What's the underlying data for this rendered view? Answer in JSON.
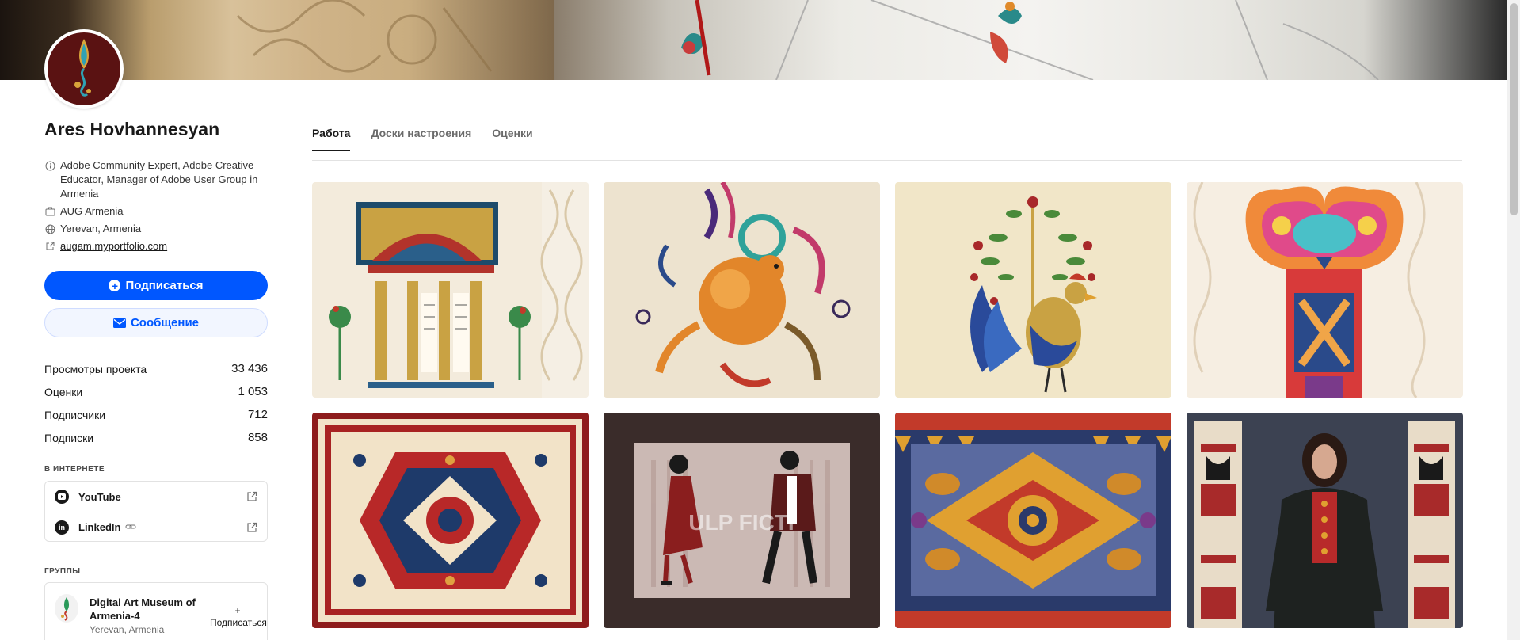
{
  "profile": {
    "name": "Ares Hovhannesyan",
    "bio": "Adobe Community Expert, Adobe Creative Educator, Manager of Adobe User Group in Armenia",
    "company": "AUG Armenia",
    "location": "Yerevan, Armenia",
    "website": "augam.myportfolio.com"
  },
  "actions": {
    "follow_label": "Подписаться",
    "message_label": "Сообщение"
  },
  "stats": [
    {
      "label": "Просмотры проекта",
      "value": "33 436"
    },
    {
      "label": "Оценки",
      "value": "1 053"
    },
    {
      "label": "Подписчики",
      "value": "712"
    },
    {
      "label": "Подписки",
      "value": "858"
    }
  ],
  "online": {
    "title": "В ИНТЕРНЕТЕ",
    "links": [
      {
        "label": "YouTube",
        "icon": "youtube-icon"
      },
      {
        "label": "LinkedIn",
        "icon": "linkedin-icon"
      }
    ]
  },
  "groups": {
    "title": "ГРУППЫ",
    "items": [
      {
        "name": "Digital Art Museum of Armenia-4",
        "location": "Yerevan, Armenia",
        "follow_label": "+ Подписаться"
      }
    ]
  },
  "tabs": [
    {
      "label": "Работа",
      "active": true
    },
    {
      "label": "Доски настроения",
      "active": false
    },
    {
      "label": "Оценки",
      "active": false
    }
  ],
  "projects": [
    {
      "id": "manuscript-arch",
      "thumbnail_text": ""
    },
    {
      "id": "griffin-ornament",
      "thumbnail_text": ""
    },
    {
      "id": "rooster-tree",
      "thumbnail_text": ""
    },
    {
      "id": "ornamental-letter",
      "thumbnail_text": ""
    },
    {
      "id": "red-carpet",
      "thumbnail_text": ""
    },
    {
      "id": "pulp-fiction-dance",
      "thumbnail_text": "ULP FICTI"
    },
    {
      "id": "gold-carpet",
      "thumbnail_text": ""
    },
    {
      "id": "woman-columns",
      "thumbnail_text": ""
    }
  ],
  "colors": {
    "accent": "#0057ff",
    "text": "#191919",
    "muted": "#6b6b6b",
    "border": "#e2e2e2"
  }
}
